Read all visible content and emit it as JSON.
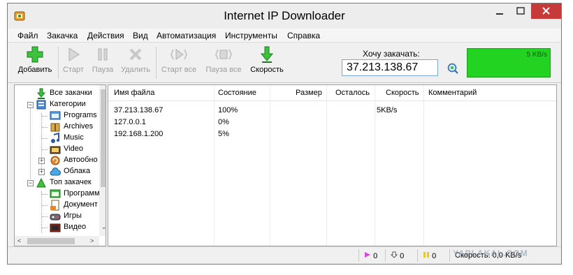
{
  "window": {
    "title": "Internet IP Downloader"
  },
  "menu": [
    "Файл",
    "Закачка",
    "Действия",
    "Вид",
    "Автоматизация",
    "Инструменты",
    "Справка"
  ],
  "toolbar": {
    "add": "Добавить",
    "start": "Старт",
    "pause": "Пауза",
    "delete": "Удалить",
    "start_all": "Старт все",
    "pause_all": "Пауза все",
    "speed": "Скорость",
    "want_label": "Хочу закачать:",
    "ip_value": "37.213.138.67",
    "graph_speed": "5 KB/s"
  },
  "tree": {
    "all": "Все закачки",
    "categories": "Категории",
    "programs": "Programs",
    "archives": "Archives",
    "music": "Music",
    "video": "Video",
    "auto": "Автообно",
    "clouds": "Облака",
    "top": "Топ закачек",
    "top_programs": "Программ",
    "top_docs": "Документ",
    "top_games": "Игры",
    "top_video": "Видео"
  },
  "columns": [
    "Имя файла",
    "Состояние",
    "Размер",
    "Осталось",
    "Скорость",
    "Комментарий"
  ],
  "rows": [
    {
      "name": "37.213.138.67",
      "status": "100%",
      "size": "",
      "left": "",
      "speed": "5KB/s",
      "comment": ""
    },
    {
      "name": "127.0.0.1",
      "status": "0%",
      "size": "",
      "left": "",
      "speed": "",
      "comment": ""
    },
    {
      "name": "192.168.1.200",
      "status": "5%",
      "size": "",
      "left": "",
      "speed": "",
      "comment": ""
    }
  ],
  "status": {
    "downloading": "0",
    "queued": "0",
    "paused": "0",
    "speed": "Скорость: 0,0 KB/s"
  },
  "watermark": "YAPLAKAL.COM",
  "colors": {
    "graph_green": "#22d322",
    "close_red": "#c73a3a",
    "input_border": "#7aa7d4"
  }
}
